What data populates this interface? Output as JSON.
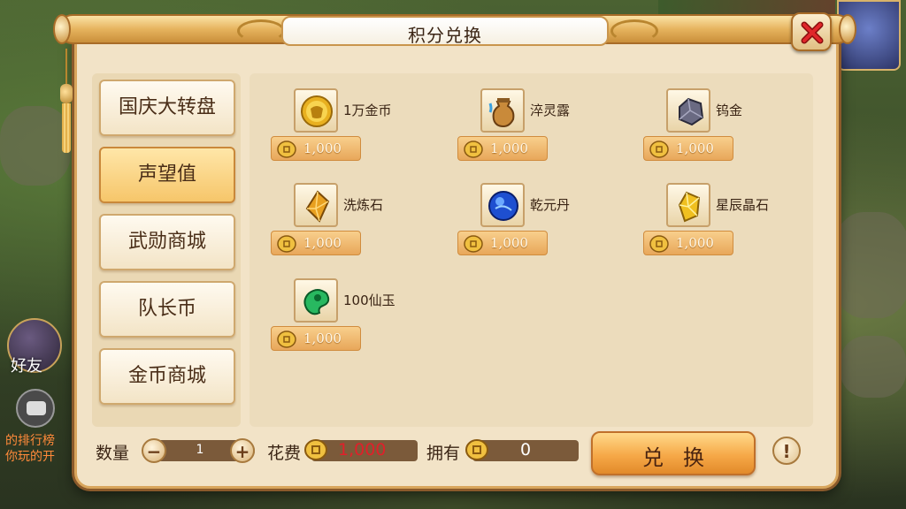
{
  "dialog": {
    "title": "积分兑换"
  },
  "tabs": [
    {
      "label": "国庆大转盘",
      "active": false
    },
    {
      "label": "声望值",
      "active": true
    },
    {
      "label": "武勋商城",
      "active": false
    },
    {
      "label": "队长币",
      "active": false
    },
    {
      "label": "金币商城",
      "active": false
    }
  ],
  "items": [
    {
      "name": "1万金币",
      "price": "1,000",
      "icon": "gold-coin-icon"
    },
    {
      "name": "淬灵露",
      "price": "1,000",
      "icon": "potion-jar-icon"
    },
    {
      "name": "钨金",
      "price": "1,000",
      "icon": "tungsten-ore-icon"
    },
    {
      "name": "洗炼石",
      "price": "1,000",
      "icon": "refine-stone-icon"
    },
    {
      "name": "乾元丹",
      "price": "1,000",
      "icon": "blue-pill-icon"
    },
    {
      "name": "星辰晶石",
      "price": "1,000",
      "icon": "star-crystal-icon"
    },
    {
      "name": "100仙玉",
      "price": "1,000",
      "icon": "jade-icon"
    }
  ],
  "footer": {
    "quantity_label": "数量",
    "quantity_value": "1",
    "minus": "−",
    "plus": "+",
    "cost_label": "花费",
    "cost_value": "1,000",
    "own_label": "拥有",
    "own_value": "0",
    "exchange_label": "兑换",
    "help": "!"
  },
  "background": {
    "friend_label": "好友",
    "chat_lines": [
      "的排行榜",
      "你玩的开"
    ]
  },
  "colors": {
    "accent": "#f6a948",
    "cost_text": "#e0202a",
    "panel": "#f2e3c7"
  }
}
